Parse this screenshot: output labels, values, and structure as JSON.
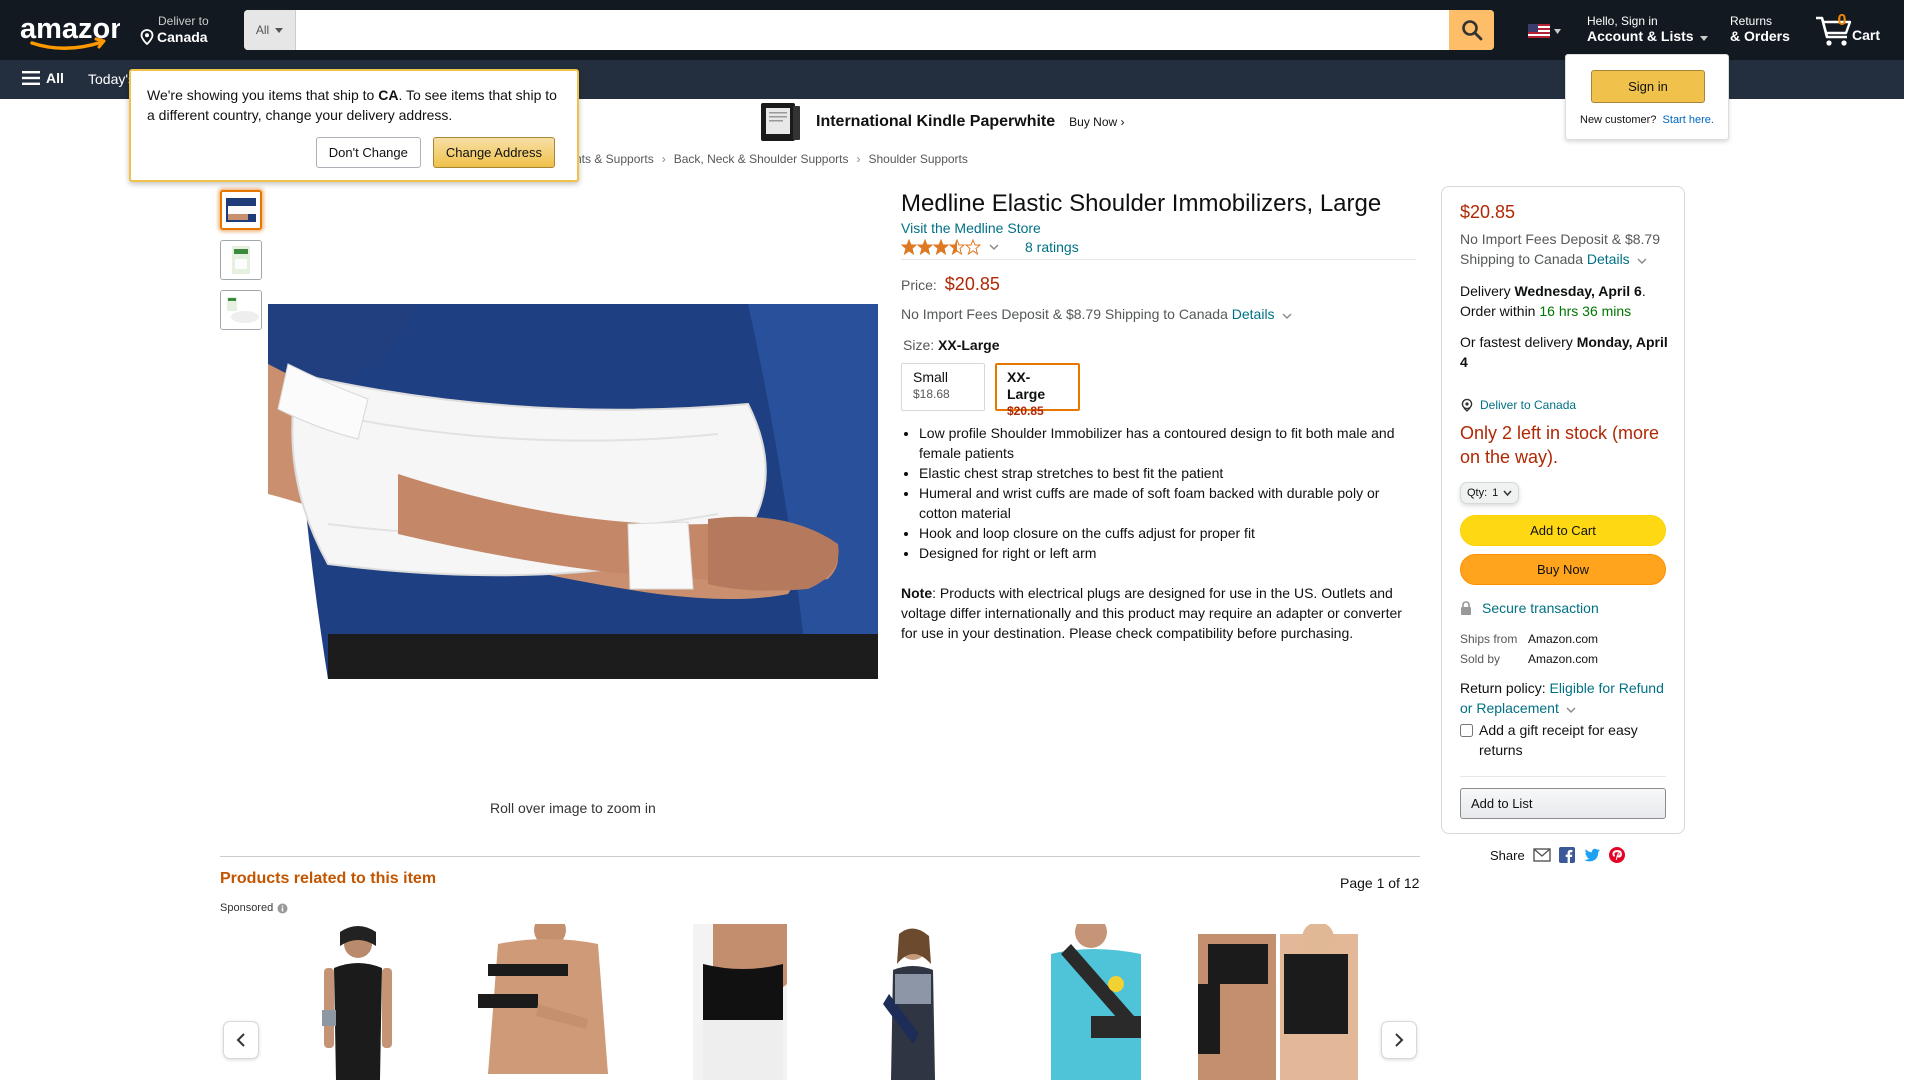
{
  "nav": {
    "deliver_label": "Deliver to",
    "deliver_location": "Canada",
    "search_category": "All",
    "search_value": "",
    "account_greeting": "Hello, Sign in",
    "account_label": "Account & Lists",
    "returns_line1": "Returns",
    "returns_line2": "& Orders",
    "cart_count": "0",
    "cart_label": "Cart",
    "all_label": "All",
    "today_label": "Today's"
  },
  "location_popover": {
    "text_before": "We're showing you items that ship to ",
    "country": "CA",
    "text_after": ". To see items that ship to a different country, change your delivery address.",
    "dont_change": "Don't Change",
    "change_address": "Change Address"
  },
  "signin_flyout": {
    "button": "Sign in",
    "new_customer": "New customer?",
    "start_here": "Start here."
  },
  "banner": {
    "title": "International Kindle Paperwhite",
    "cta": "Buy Now ›"
  },
  "breadcrumbs": [
    "nts & Supports",
    "Back, Neck & Shoulder Supports",
    "Shoulder Supports"
  ],
  "product": {
    "title": "Medline Elastic Shoulder Immobilizers, Large",
    "store_link": "Visit the Medline Store",
    "rating": 3.5,
    "ratings_count": "8 ratings",
    "price_label": "Price:",
    "price": "$20.85",
    "fees_text": "No Import Fees Deposit & $8.79 Shipping to Canada",
    "details_link": "Details",
    "size_label": "Size:",
    "size_selected": "XX-Large",
    "sizes": [
      {
        "name": "Small",
        "price": "$18.68"
      },
      {
        "name": "XX-Large",
        "price": "$20.85"
      }
    ],
    "bullets": [
      "Low profile Shoulder Immobilizer has a contoured design to fit both male and female patients",
      "Elastic chest strap stretches to best fit the patient",
      "Humeral and wrist cuffs are made of soft foam backed with durable poly or cotton material",
      "Hook and loop closure on the cuffs adjust for proper fit",
      "Designed for right or left arm"
    ],
    "note_label": "Note",
    "note_text": ": Products with electrical plugs are designed for use in the US. Outlets and voltage differ internationally and this product may require an adapter or converter for use in your destination. Please check compatibility before purchasing.",
    "zoom_hint": "Roll over image to zoom in"
  },
  "buybox": {
    "price": "$20.85",
    "fees_text": "No Import Fees Deposit & $8.79 Shipping to Canada",
    "details_link": "Details",
    "delivery_prefix": "Delivery",
    "delivery_date": "Wednesday, April 6",
    "order_within_prefix": "Order within",
    "order_within": "16 hrs 36 mins",
    "fastest_prefix": "Or fastest delivery",
    "fastest_date": "Monday, April 4",
    "deliver_to": "Deliver to Canada",
    "stock": "Only 2 left in stock (more on the way).",
    "qty_label": "Qty:",
    "qty_value": "1",
    "add_to_cart": "Add to Cart",
    "buy_now": "Buy Now",
    "secure": "Secure transaction",
    "ships_from_label": "Ships from",
    "ships_from": "Amazon.com",
    "sold_by_label": "Sold by",
    "sold_by": "Amazon.com",
    "return_label": "Return policy:",
    "return_link": "Eligible for Refund or Replacement",
    "gift_label": "Add a gift receipt for easy returns",
    "add_to_list": "Add to List",
    "share_label": "Share"
  },
  "related": {
    "title": "Products related to this item",
    "page": "Page 1 of 12",
    "sponsored": "Sponsored"
  },
  "colors": {
    "nav_dark": "#131921",
    "nav_secondary": "#232f3e",
    "price_red": "#B12704",
    "link_teal": "#007185",
    "accent_orange": "#c45500",
    "cart_yellow": "#FFD814",
    "buy_orange": "#FFA41C"
  }
}
